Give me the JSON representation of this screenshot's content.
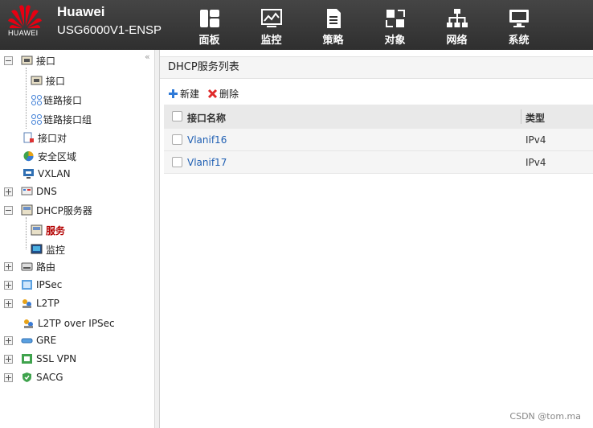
{
  "header": {
    "logo_text": "HUAWEI",
    "brand": "Huawei",
    "model": "USG6000V1-ENSP",
    "nav": [
      {
        "label": "面板",
        "icon": "dashboard-icon"
      },
      {
        "label": "监控",
        "icon": "monitor-icon"
      },
      {
        "label": "策略",
        "icon": "policy-icon"
      },
      {
        "label": "对象",
        "icon": "object-icon"
      },
      {
        "label": "网络",
        "icon": "network-icon"
      },
      {
        "label": "系统",
        "icon": "system-icon"
      }
    ]
  },
  "sidebar": {
    "collapse": "«",
    "items": [
      {
        "label": "接口"
      },
      {
        "label": "接口"
      },
      {
        "label": "链路接口"
      },
      {
        "label": "链路接口组"
      },
      {
        "label": "接口对"
      },
      {
        "label": "安全区域"
      },
      {
        "label": "VXLAN"
      },
      {
        "label": "DNS"
      },
      {
        "label": "DHCP服务器"
      },
      {
        "label": "服务"
      },
      {
        "label": "监控"
      },
      {
        "label": "路由"
      },
      {
        "label": "IPSec"
      },
      {
        "label": "L2TP"
      },
      {
        "label": "L2TP over IPSec"
      },
      {
        "label": "GRE"
      },
      {
        "label": "SSL VPN"
      },
      {
        "label": "SACG"
      }
    ]
  },
  "main": {
    "title": "DHCP服务列表",
    "toolbar": {
      "new_label": "新建",
      "delete_label": "删除"
    },
    "columns": [
      "接口名称",
      "类型"
    ],
    "rows": [
      {
        "name": "Vlanif16",
        "type": "IPv4"
      },
      {
        "name": "Vlanif17",
        "type": "IPv4"
      }
    ]
  },
  "watermark": "CSDN @tom.ma",
  "colors": {
    "header_bg": "#3a3a3a",
    "active_item": "#b30000",
    "link": "#1f5fb3",
    "logo_red": "#e60012"
  }
}
